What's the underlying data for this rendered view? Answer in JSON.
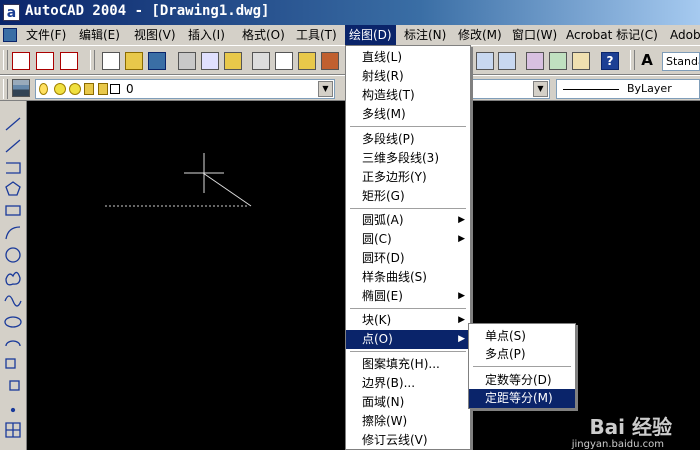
{
  "window": {
    "title": "AutoCAD 2004 - [Drawing1.dwg]",
    "app_icon_letter": "a"
  },
  "menubar": {
    "items": [
      {
        "label": "文件(F)"
      },
      {
        "label": "编辑(E)"
      },
      {
        "label": "视图(V)"
      },
      {
        "label": "插入(I)"
      },
      {
        "label": "格式(O)"
      },
      {
        "label": "工具(T)"
      },
      {
        "label": "绘图(D)",
        "active": true
      },
      {
        "label": "标注(N)"
      },
      {
        "label": "修改(M)"
      },
      {
        "label": "窗口(W)"
      },
      {
        "label": "Acrobat 标记(C)"
      },
      {
        "label": "Adobe"
      }
    ]
  },
  "toolbar": {
    "text_style_value": "Standa",
    "layer_value": "0",
    "linetype_value": "ByLayer"
  },
  "draw_menu": {
    "groups": [
      [
        "直线(L)",
        "射线(R)",
        "构造线(T)",
        "多线(M)"
      ],
      [
        "多段线(P)",
        "三维多段线(3)",
        "正多边形(Y)",
        "矩形(G)"
      ],
      [
        "圆弧(A)",
        "圆(C)",
        "圆环(D)",
        "样条曲线(S)",
        "椭圆(E)"
      ],
      [
        "块(K)",
        "点(O)"
      ],
      [
        "图案填充(H)...",
        "边界(B)...",
        "面域(N)",
        "擦除(W)",
        "修订云线(V)"
      ]
    ],
    "highlighted": "点(O)"
  },
  "point_submenu": {
    "items": [
      "单点(S)",
      "多点(P)",
      "定数等分(D)",
      "定距等分(M)"
    ],
    "highlighted": "定距等分(M)"
  },
  "watermark": {
    "text": "Bai 经验",
    "url": "jingyan.baidu.com"
  },
  "colors": {
    "menu_highlight": "#0a246a",
    "canvas": "#000000",
    "face": "#d4d0c8"
  }
}
